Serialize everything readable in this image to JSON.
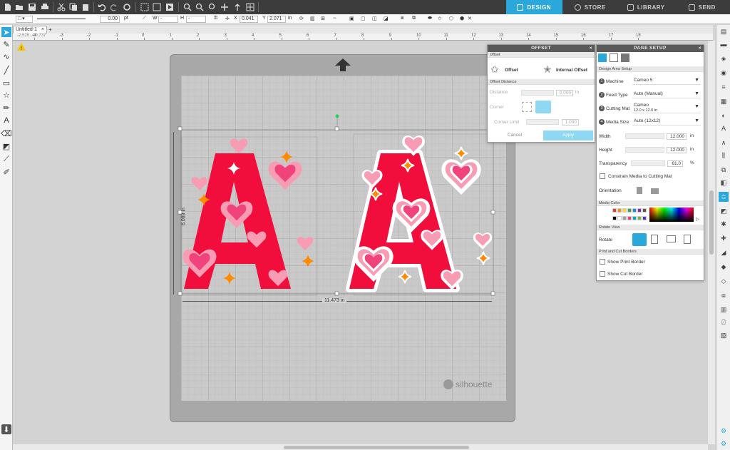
{
  "app": {
    "doc_tab": "Untitled-1",
    "warning": "!"
  },
  "nav": [
    {
      "label": "DESIGN",
      "active": true
    },
    {
      "label": "STORE",
      "active": false
    },
    {
      "label": "LIBRARY",
      "active": false
    },
    {
      "label": "SEND",
      "active": false
    }
  ],
  "optbar": {
    "line_width": "0.00",
    "unit": "pt",
    "w_label": "W",
    "w_value": "-",
    "h_label": "H",
    "h_value": "-",
    "x_label": "X",
    "x_value": "0.041",
    "y_label": "Y",
    "y_value": "2.071",
    "in": "in"
  },
  "ruler": {
    "coord": "-2.578 , 10.737",
    "labels": [
      "-4",
      "-3",
      "-2",
      "-1",
      "0",
      "1",
      "2",
      "3",
      "4",
      "5",
      "6",
      "7",
      "8",
      "9",
      "10",
      "11",
      "12",
      "13",
      "14",
      "15",
      "16",
      "17",
      "18"
    ]
  },
  "canvas": {
    "height_dim": "6.089 in",
    "width_dim": "11.473 in",
    "watermark": "silhouette"
  },
  "offset_panel": {
    "title": "OFFSET",
    "section": "Offset",
    "offset_btn": "Offset",
    "internal_btn": "Internal Offset",
    "distance_section": "Offset Distance",
    "distance_label": "Distance",
    "distance_value": "0.000",
    "distance_unit": "in",
    "corner_label": "Corner",
    "corner_limit_label": "Corner Limit",
    "corner_limit_value": "1.000",
    "cancel": "Cancel",
    "apply": "Apply"
  },
  "page_setup": {
    "title": "PAGE SETUP",
    "section": "Design Area Setup",
    "machine_label": "Machine",
    "machine_value": "Cameo 5",
    "feed_label": "Feed Type",
    "feed_value": "Auto (Manual)",
    "mat_label": "Cutting Mat",
    "mat_value": "Cameo",
    "mat_sub": "12.0 x 12.0 in",
    "media_label": "Media Size",
    "media_value": "Auto (12x12)",
    "width_label": "Width",
    "width_value": "12.000",
    "height_label": "Height",
    "height_value": "12.000",
    "unit": "in",
    "transparency_label": "Transparency",
    "transparency_value": "61.0",
    "pct": "%",
    "constrain_label": "Constrain Media to Cutting Mat",
    "orientation_label": "Orientation",
    "media_color_section": "Media Color",
    "rotate_section": "Rotate View",
    "rotate_label": "Rotate",
    "borders_section": "Print and Cut Borders",
    "show_print": "Show Print Border",
    "show_cut": "Show Cut Border",
    "swatches": [
      "#e53935",
      "#fb8c00",
      "#fdd835",
      "#43a047",
      "#1e88e5",
      "#8e24aa",
      "#6d4c41",
      "#000000",
      "#ffffff",
      "#9e9e9e",
      "#ec407a",
      "#00acc1",
      "#7cb342",
      "#5e35b1"
    ]
  },
  "colors": {
    "accent": "#2aa8dc",
    "letter": "#f20e3c",
    "heart_light": "#f79cb3",
    "heart_dark": "#f0437c",
    "sparkle": "#ff8c00"
  }
}
